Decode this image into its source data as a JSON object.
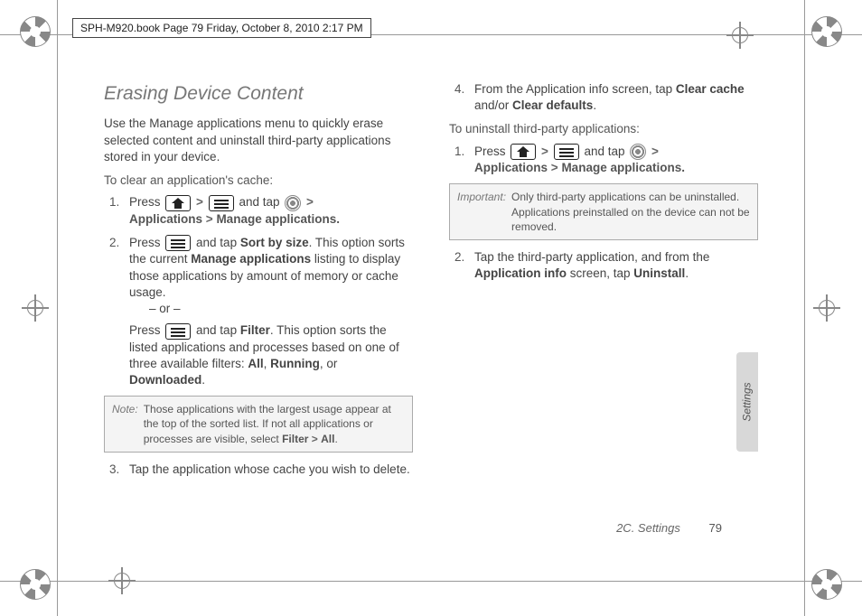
{
  "header": {
    "running": "SPH-M920.book  Page 79  Friday, October 8, 2010  2:17 PM"
  },
  "section": {
    "title": "Erasing Device Content"
  },
  "left": {
    "intro": "Use the Manage applications menu to quickly erase selected content and uninstall third-party applications stored in your device.",
    "sub1": "To clear an application's cache:",
    "s1a": "Press ",
    "s1b": " and tap ",
    "s1c": "Applications",
    "s1d": "Manage applications.",
    "s2a": "Press ",
    "s2b": " and tap ",
    "s2c": "Sort by size",
    "s2d": ". This option sorts the current ",
    "s2e": "Manage applications",
    "s2f": " listing to display those applications by amount of memory or cache usage.",
    "or": "– or –",
    "s2g": "Press ",
    "s2h": " and tap ",
    "s2i": "Filter",
    "s2j": ". This option sorts the listed applications and processes based on one of three available filters: ",
    "s2k": "All",
    "s2l": "Running",
    "s2m": "Downloaded",
    "note_label": "Note:",
    "note_body_a": "Those applications with the largest usage appear at the top of the sorted list. If not all applications or processes are visible, select ",
    "note_body_b": "Filter",
    "note_body_c": "All",
    "s3": "Tap the application whose cache you wish to delete."
  },
  "right": {
    "s4a": "From the Application info screen, tap ",
    "s4b": "Clear cache",
    "s4c": " and/or ",
    "s4d": "Clear defaults",
    "sub2": "To uninstall third-party applications:",
    "u1a": "Press ",
    "u1b": " and tap ",
    "u1c": "Applications",
    "u1d": "Manage applications.",
    "imp_label": "Important:",
    "imp_body": "Only third-party applications can be uninstalled. Applications preinstalled on the device can not be removed.",
    "u2a": "Tap the third-party application, and from the ",
    "u2b": "Application info",
    "u2c": " screen, tap ",
    "u2d": "Uninstall"
  },
  "sidetab": "Settings",
  "footer": {
    "section": "2C. Settings",
    "page": "79"
  },
  "gt": ">"
}
